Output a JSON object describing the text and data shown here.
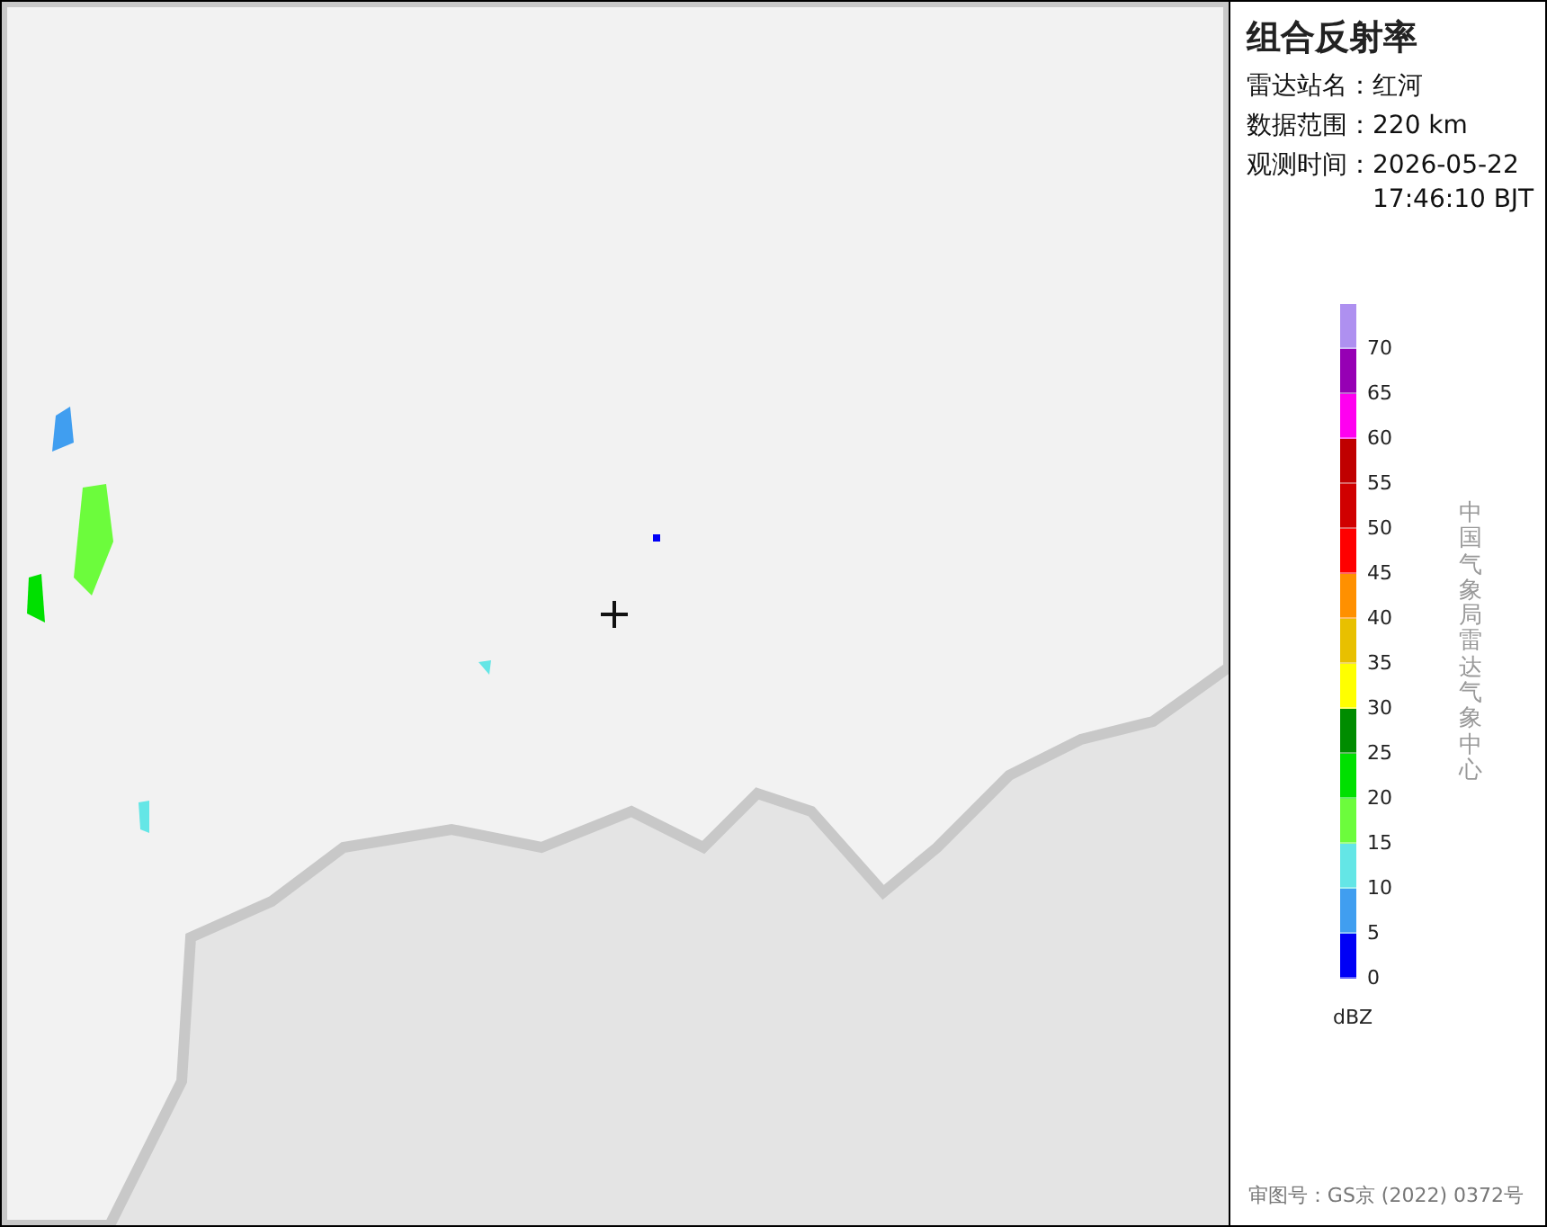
{
  "product": {
    "title": "组合反射率"
  },
  "info": [
    {
      "label": "雷达站名：",
      "value": "红河"
    },
    {
      "label": "数据范围：",
      "value": "220 km"
    },
    {
      "label": "观测时间：",
      "value": "2026-05-22\n17:46:10 BJT"
    }
  ],
  "legend": {
    "unit": "dBZ",
    "entries": [
      {
        "label": "70",
        "color": "#ae90f0"
      },
      {
        "label": "65",
        "color": "#9600b4"
      },
      {
        "label": "60",
        "color": "#ff00f0"
      },
      {
        "label": "55",
        "color": "#c00000"
      },
      {
        "label": "50",
        "color": "#d00000"
      },
      {
        "label": "45",
        "color": "#ff0000"
      },
      {
        "label": "40",
        "color": "#ff9000"
      },
      {
        "label": "35",
        "color": "#e8c000"
      },
      {
        "label": "30",
        "color": "#ffff00"
      },
      {
        "label": "25",
        "color": "#008c00"
      },
      {
        "label": "20",
        "color": "#00e000"
      },
      {
        "label": "15",
        "color": "#6cfc3c"
      },
      {
        "label": "10",
        "color": "#64e6e6"
      },
      {
        "label": "5",
        "color": "#409ef0"
      },
      {
        "label": "0",
        "color": "#0000f6"
      }
    ]
  },
  "credit": "中国气象局雷达气象中心",
  "map_approval": "审图号：GS京 (2022) 0372号"
}
